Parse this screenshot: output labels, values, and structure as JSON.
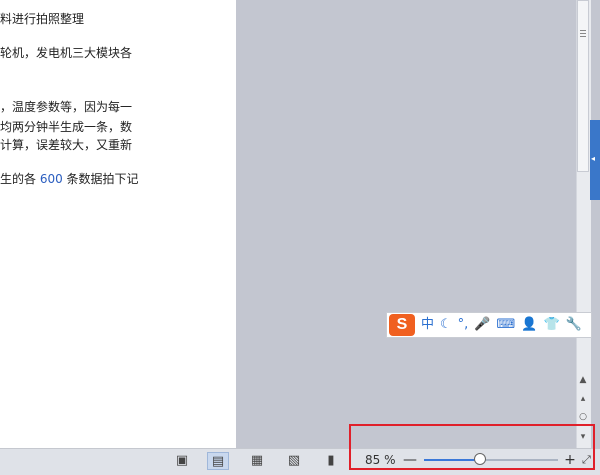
{
  "document": {
    "lines": [
      {
        "text": "料进行拍照整理"
      },
      {
        "text": "轮机，发电机三大模块各"
      },
      {
        "text": "，温度参数等，因为每一"
      },
      {
        "text": "均两分钟半生成一条，数"
      },
      {
        "text": "计算，误差较大，又重新"
      },
      {
        "pre": "生的各 ",
        "num": "600",
        "post": " 条数据拍下记"
      }
    ]
  },
  "ime": {
    "logo": "S",
    "items": [
      "中",
      "☾",
      "°,",
      "🎤",
      "⌨",
      "👤",
      "👕",
      "🔧"
    ]
  },
  "status_bar": {
    "zoom_label": "85 %",
    "zoom_percent": 85,
    "minus": "—",
    "plus": "+",
    "icons": [
      "fit-page-icon",
      "page-view-icon",
      "outline-view-icon",
      "web-view-icon",
      "read-mode-icon"
    ]
  },
  "scrollbar": {
    "up_label": "▲",
    "prev_label": "▴",
    "dot_label": "○",
    "next_label": "▾"
  },
  "colors": {
    "highlight": "#e0202a",
    "accent": "#3b78d8",
    "ime_logo": "#f06020"
  }
}
